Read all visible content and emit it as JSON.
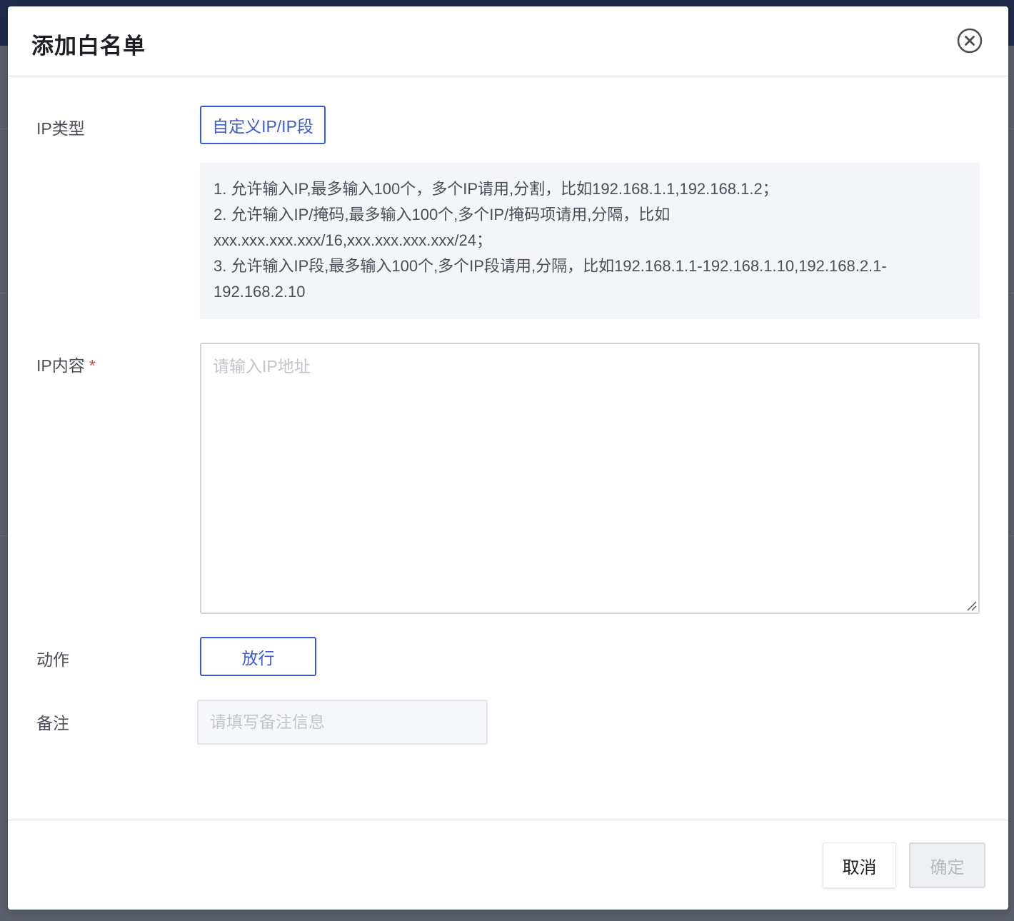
{
  "dialog": {
    "title": "添加白名单"
  },
  "form": {
    "ip_type": {
      "label": "IP类型",
      "selected_option": "自定义IP/IP段"
    },
    "hints": [
      "1. 允许输入IP,最多输入100个，多个IP请用,分割，比如192.168.1.1,192.168.1.2；",
      "2. 允许输入IP/掩码,最多输入100个,多个IP/掩码项请用,分隔，比如",
      "xxx.xxx.xxx.xxx/16,xxx.xxx.xxx.xxx/24；",
      "3. 允许输入IP段,最多输入100个,多个IP段请用,分隔，比如192.168.1.1-192.168.1.10,192.168.2.1-",
      "192.168.2.10"
    ],
    "ip_content": {
      "label": "IP内容",
      "required_mark": "*",
      "placeholder": "请输入IP地址",
      "value": ""
    },
    "action": {
      "label": "动作",
      "selected_option": "放行"
    },
    "remark": {
      "label": "备注",
      "placeholder": "请填写备注信息",
      "value": ""
    }
  },
  "footer": {
    "cancel_label": "取消",
    "confirm_label": "确定"
  },
  "icons": {
    "close": "close-circle-icon",
    "resize": "resize-grip-icon"
  },
  "colors": {
    "accent": "#3a5bd9",
    "required": "#e04a3b",
    "hint_background": "#f4f5f9"
  }
}
